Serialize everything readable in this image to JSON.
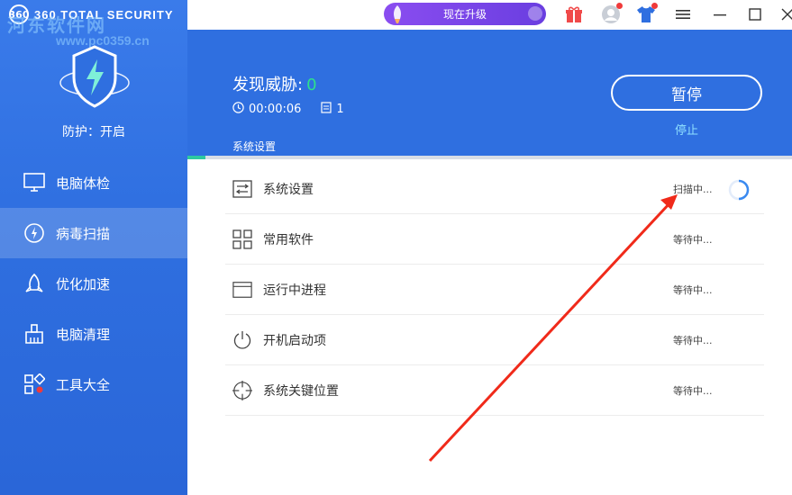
{
  "app": {
    "brand": "360 TOTAL SECURITY",
    "brand_logo": "360"
  },
  "watermark": {
    "main": "河东软件网",
    "url": "www.pc0359.cn"
  },
  "sidebar": {
    "protection": "防护：开启",
    "items": [
      {
        "label": "电脑体检",
        "icon": "monitor-icon"
      },
      {
        "label": "病毒扫描",
        "icon": "virus-scan-icon",
        "active": true
      },
      {
        "label": "优化加速",
        "icon": "rocket-icon"
      },
      {
        "label": "电脑清理",
        "icon": "broom-icon"
      },
      {
        "label": "工具大全",
        "icon": "tools-grid-icon"
      }
    ]
  },
  "topbar": {
    "upgrade_label": "现在升级"
  },
  "scan": {
    "threat_label": "发现威胁:",
    "threat_count": "0",
    "elapsed": "00:00:06",
    "file_count": "1",
    "current_item": "系统设置",
    "pause_label": "暂停",
    "stop_label": "停止",
    "progress": 0.03
  },
  "rows": [
    {
      "label": "系统设置",
      "status": "扫描中...",
      "icon": "settings-icon",
      "scanning": true
    },
    {
      "label": "常用软件",
      "status": "等待中...",
      "icon": "apps-grid-icon"
    },
    {
      "label": "运行中进程",
      "status": "等待中...",
      "icon": "window-icon"
    },
    {
      "label": "开机启动项",
      "status": "等待中...",
      "icon": "power-icon"
    },
    {
      "label": "系统关键位置",
      "status": "等待中...",
      "icon": "crosshair-icon"
    }
  ],
  "colors": {
    "sidebar": "#2f6fe0",
    "accent_green": "#2de08c",
    "progress": "#2dc8a0",
    "upgrade": "#7a45e8",
    "arrow": "#f02a1a"
  }
}
